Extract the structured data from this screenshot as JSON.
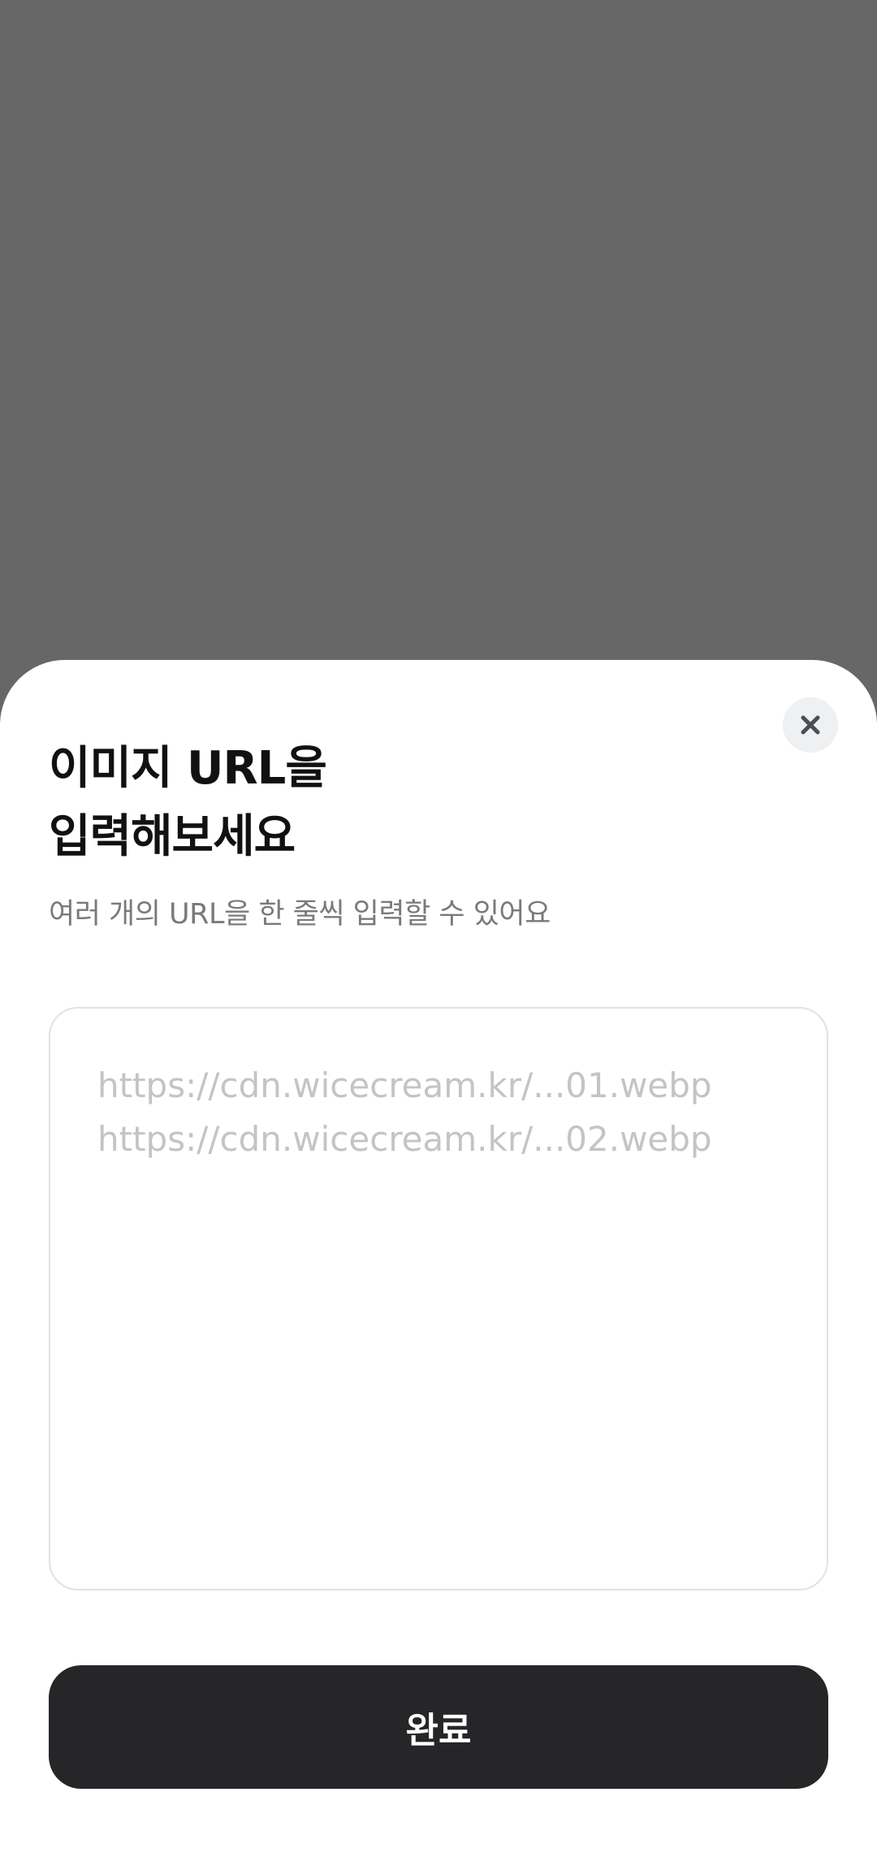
{
  "dialog": {
    "title_line1": "이미지 URL을",
    "title_line2": "입력해보세요",
    "subtitle": "여러 개의 URL을 한 줄씩 입력할 수 있어요",
    "close_icon": "close-icon"
  },
  "url_input": {
    "value": "",
    "placeholder_lines": [
      "https://cdn.wicecream.kr/...01.webp",
      "https://cdn.wicecream.kr/...02.webp"
    ]
  },
  "done_button": {
    "label": "완료"
  },
  "colors": {
    "overlay": "#676767",
    "sheet": "#ffffff",
    "title_text": "#111111",
    "subtitle_text": "#7a7a7a",
    "placeholder_text": "#c4c4c6",
    "input_border": "#e2e2e2",
    "close_button_bg": "#eef0f2",
    "close_icon": "#4a4f55",
    "primary_button": "#262628",
    "primary_button_text": "#ffffff"
  }
}
